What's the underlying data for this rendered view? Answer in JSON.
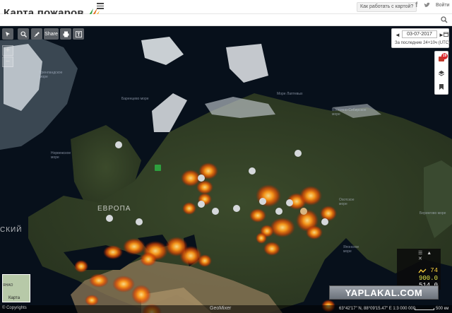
{
  "header": {
    "logo_text": "Карта пожаров",
    "how_button": "Как работать с картой?",
    "facebook": "f",
    "login": "Войти"
  },
  "search": {
    "placeholder": ""
  },
  "toolbar": {
    "share_label": "Share"
  },
  "date_panel": {
    "prev": "◄",
    "date": "03-07-2017",
    "next": "►",
    "range": "За последние 24+10ч (UTC)"
  },
  "side_panel": {
    "badge": "19"
  },
  "map_labels": {
    "europe": "ЕВРОПА",
    "left_edge": "СКИЙ",
    "greenland_sea": "Гренландское море",
    "barents_sea": "Баренцево море",
    "norwegian_sea": "Норвежское море",
    "laptev_sea": "Море Лаптевых",
    "east_siberian_sea": "Восточно-Сибирское море",
    "okhotsk_sea": "Охотское море",
    "japan_sea": "Японское море",
    "bering_sea": "Берингово море"
  },
  "legend": {
    "v1": "74",
    "v2": "900.0",
    "v3": "514.0",
    "controls": "☰ ▲ ✕"
  },
  "minimap": {
    "label": "Карта",
    "top_label": "ЯНАО"
  },
  "bottom": {
    "copyright": "© Copyrights",
    "geomixer": "GeoMixer",
    "coords": "63°42'17\" N, 88°09'15.47\" E  1:3 000 000",
    "scale": "500 км"
  },
  "watermark": "YAPLAKAL.COM",
  "colors": {
    "fire_core": "#ffd36b",
    "fire_glow": "#ff6a00",
    "ocean": "#07101b",
    "land": "#2d3a22"
  }
}
